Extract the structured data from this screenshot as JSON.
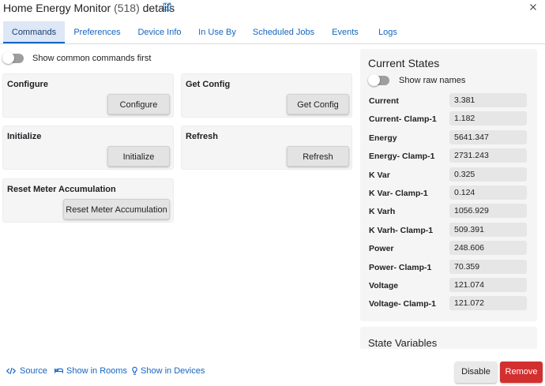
{
  "header": {
    "title": "Home Energy Monitor",
    "count": "(518)",
    "suffix": "details"
  },
  "tabs": [
    {
      "label": "Commands",
      "active": true
    },
    {
      "label": "Preferences"
    },
    {
      "label": "Device Info"
    },
    {
      "label": "In Use By"
    },
    {
      "label": "Scheduled Jobs"
    },
    {
      "label": "Events"
    },
    {
      "label": "Logs"
    }
  ],
  "commands_toggle": {
    "label": "Show common commands first",
    "on": false
  },
  "commands": [
    {
      "title": "Configure",
      "button": "Configure"
    },
    {
      "title": "Get Config",
      "button": "Get Config"
    },
    {
      "title": "Initialize",
      "button": "Initialize"
    },
    {
      "title": "Refresh",
      "button": "Refresh"
    },
    {
      "title": "Reset Meter Accumulation",
      "button": "Reset Meter Accumulation"
    }
  ],
  "current_states": {
    "title": "Current States",
    "raw_names_toggle": {
      "label": "Show raw names",
      "on": false
    },
    "rows": [
      {
        "label": "Current",
        "value": "3.381"
      },
      {
        "label": "Current- Clamp-1",
        "value": "1.182"
      },
      {
        "label": "Energy",
        "value": "5641.347"
      },
      {
        "label": "Energy- Clamp-1",
        "value": "2731.243"
      },
      {
        "label": "K Var",
        "value": "0.325"
      },
      {
        "label": "K Var- Clamp-1",
        "value": "0.124"
      },
      {
        "label": "K Varh",
        "value": "1056.929"
      },
      {
        "label": "K Varh- Clamp-1",
        "value": "509.391"
      },
      {
        "label": "Power",
        "value": "248.606"
      },
      {
        "label": "Power- Clamp-1",
        "value": "70.359"
      },
      {
        "label": "Voltage",
        "value": "121.074"
      },
      {
        "label": "Voltage- Clamp-1",
        "value": "121.072"
      }
    ]
  },
  "state_variables": {
    "title": "State Variables"
  },
  "footer": {
    "source": "Source",
    "show_in_rooms": "Show in Rooms",
    "show_in_devices": "Show in Devices",
    "disable": "Disable",
    "remove": "Remove"
  },
  "colors": {
    "accent": "#1565c0",
    "danger": "#d32f2f",
    "panel": "#f5f5f5"
  },
  "icons": {
    "title_link": "external-link-icon",
    "close": "close-icon",
    "source": "code-icon",
    "rooms": "bed-icon",
    "devices": "lightbulb-icon"
  }
}
